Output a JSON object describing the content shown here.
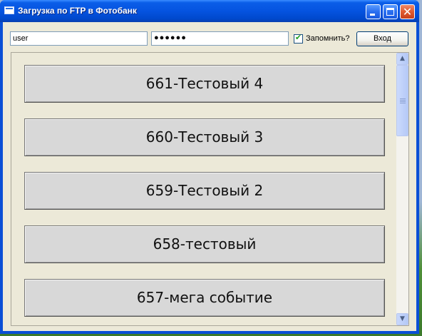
{
  "window": {
    "title": "Загрузка по FTP в Фотобанк",
    "close_glyph": "✕"
  },
  "login": {
    "username": "user",
    "password_masked": "●●●●●●",
    "remember_label": "Запомнить?",
    "remember_checked": true,
    "login_label": "Вход"
  },
  "events": [
    {
      "label": "661-Тестовый 4"
    },
    {
      "label": "660-Тестовый 3"
    },
    {
      "label": "659-Тестовый 2"
    },
    {
      "label": "658-тестовый"
    },
    {
      "label": "657-мега событие"
    }
  ],
  "icons": {
    "window": "app-window-icon",
    "check": "✔",
    "up": "▲",
    "down": "▼"
  },
  "colors": {
    "titlebar": "#0553e0",
    "client_bg": "#ece9d8",
    "button_bg": "#d8d8d8",
    "close_button": "#e05a30"
  }
}
